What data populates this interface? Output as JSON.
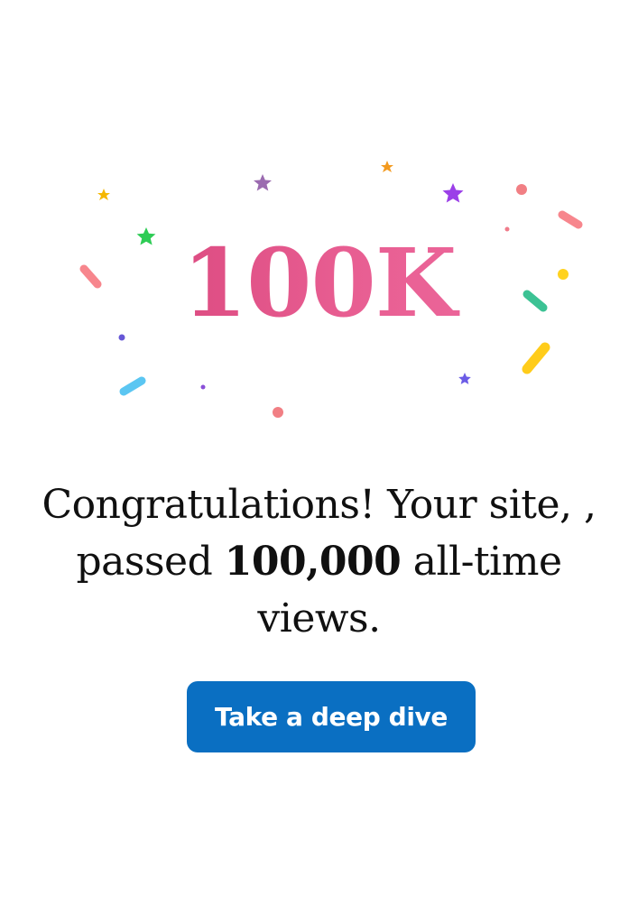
{
  "milestone": {
    "badge": "100K"
  },
  "message": {
    "before": "Congratulations! Your site, , passed ",
    "count": "100,000",
    "after": " all-time views."
  },
  "cta": {
    "label": "Take a deep dive"
  },
  "colors": {
    "button": "#0a6fc2",
    "badge_gradient_start": "#d23a72",
    "badge_gradient_end": "#f06fa2",
    "text": "#101010"
  },
  "confetti_icons": [
    "star-icon",
    "confetti-dot-icon",
    "confetti-stick-icon"
  ]
}
